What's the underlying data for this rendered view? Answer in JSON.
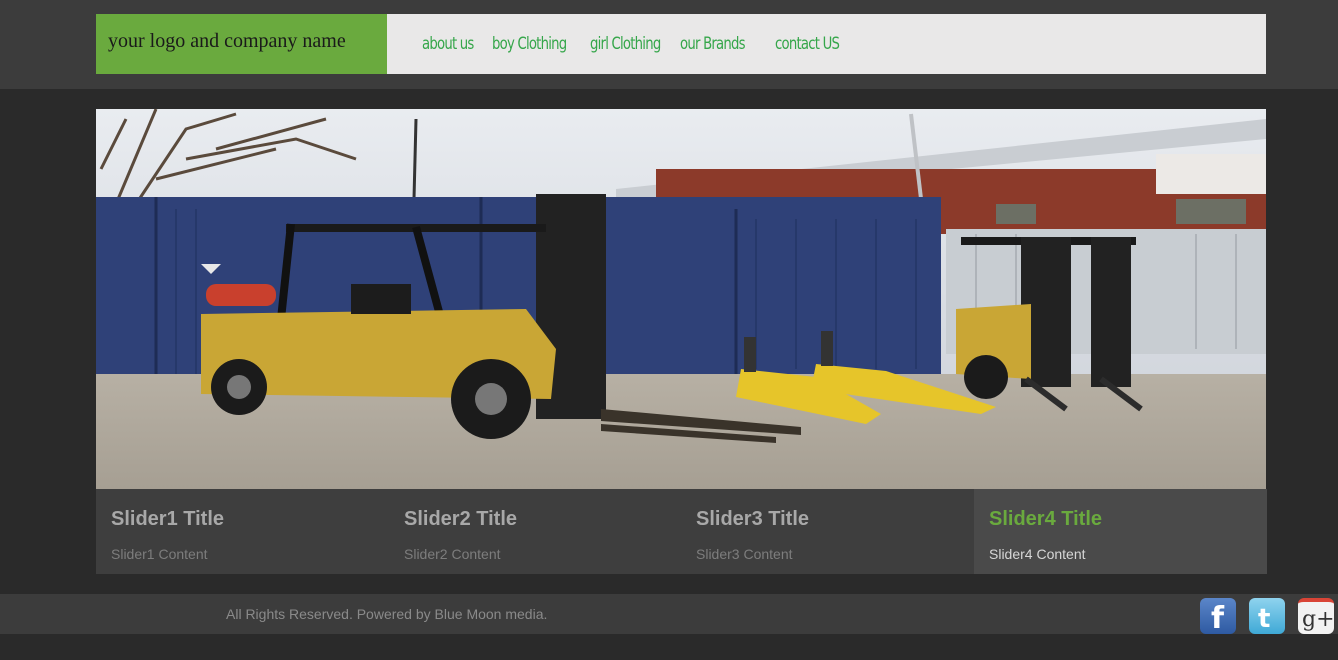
{
  "header": {
    "logo_text": "your logo and company name",
    "nav": [
      "about us",
      "boy Clothing",
      "girl Clothing",
      "our Brands",
      "contact US"
    ]
  },
  "slider": {
    "tabs": [
      {
        "title": "Slider1 Title",
        "content": "Slider1 Content",
        "active": false
      },
      {
        "title": "Slider2 Title",
        "content": "Slider2 Content",
        "active": false
      },
      {
        "title": "Slider3 Title",
        "content": "Slider3 Content",
        "active": false
      },
      {
        "title": "Slider4 Title",
        "content": "Slider4 Content",
        "active": true
      }
    ]
  },
  "footer": {
    "text": "All Rights Reserved. Powered by Blue Moon media.",
    "social_icons": [
      "facebook-icon",
      "twitter-icon",
      "google-plus-icon"
    ]
  },
  "colors": {
    "accent_green": "#6aaa3e",
    "nav_green": "#35a64a"
  }
}
